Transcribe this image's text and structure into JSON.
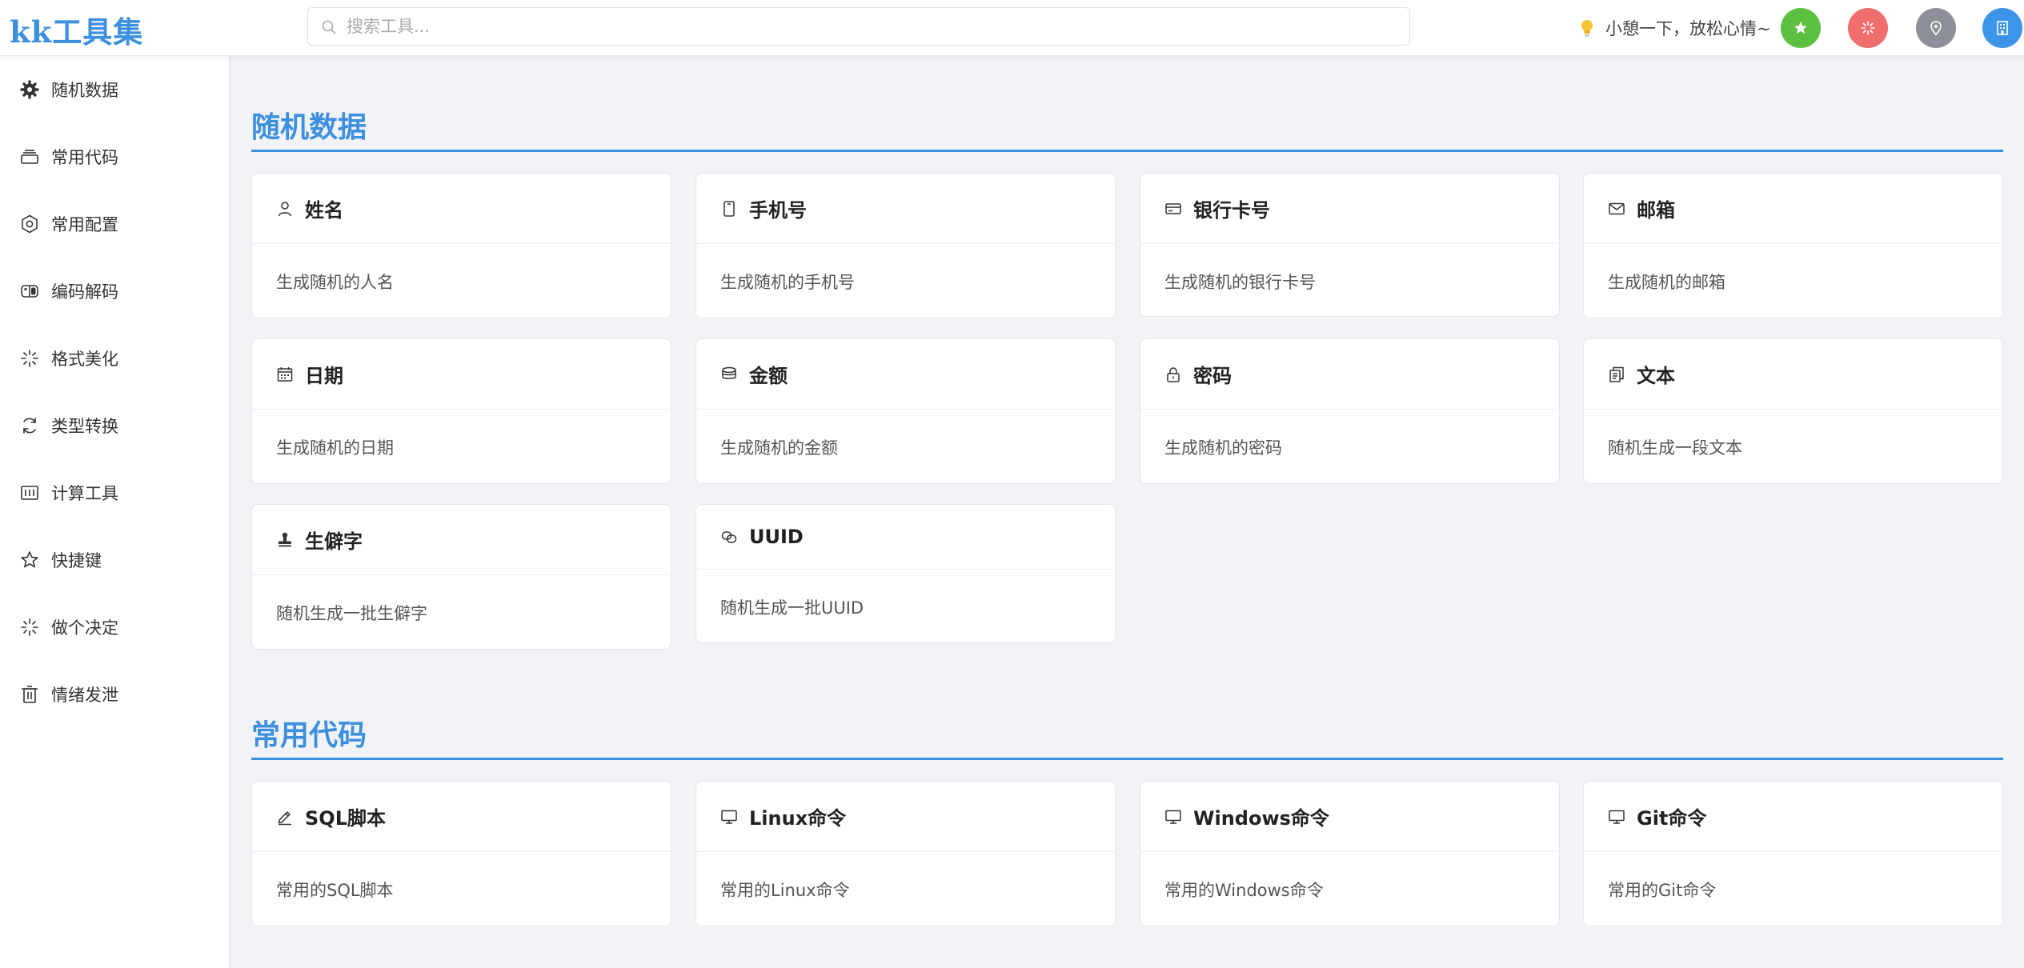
{
  "header": {
    "logo": "kk工具集",
    "search_placeholder": "搜索工具...",
    "tip": "小憩一下，放松心情~",
    "buttons": [
      {
        "icon": "star-icon",
        "color": "#5cc041"
      },
      {
        "icon": "sparkle-icon",
        "color": "#f26d6d"
      },
      {
        "icon": "pin-icon",
        "color": "#8d9096"
      },
      {
        "icon": "building-icon",
        "color": "#3d95ea"
      }
    ]
  },
  "sidebar": {
    "items": [
      {
        "label": "随机数据",
        "icon": "gear-icon"
      },
      {
        "label": "常用代码",
        "icon": "stack-icon"
      },
      {
        "label": "常用配置",
        "icon": "settings-icon"
      },
      {
        "label": "编码解码",
        "icon": "switch-icon"
      },
      {
        "label": "格式美化",
        "icon": "loading-icon"
      },
      {
        "label": "类型转换",
        "icon": "refresh-icon"
      },
      {
        "label": "计算工具",
        "icon": "calculator-icon"
      },
      {
        "label": "快捷键",
        "icon": "star-outline-icon"
      },
      {
        "label": "做个决定",
        "icon": "loading-icon"
      },
      {
        "label": "情绪发泄",
        "icon": "trash-icon"
      }
    ]
  },
  "sections": [
    {
      "title": "随机数据",
      "cards": [
        {
          "title": "姓名",
          "desc": "生成随机的人名",
          "icon": "user-icon"
        },
        {
          "title": "手机号",
          "desc": "生成随机的手机号",
          "icon": "phone-icon"
        },
        {
          "title": "银行卡号",
          "desc": "生成随机的银行卡号",
          "icon": "credit-card-icon"
        },
        {
          "title": "邮箱",
          "desc": "生成随机的邮箱",
          "icon": "mail-icon"
        },
        {
          "title": "日期",
          "desc": "生成随机的日期",
          "icon": "calendar-icon"
        },
        {
          "title": "金额",
          "desc": "生成随机的金额",
          "icon": "coins-icon"
        },
        {
          "title": "密码",
          "desc": "生成随机的密码",
          "icon": "lock-icon"
        },
        {
          "title": "文本",
          "desc": "随机生成一段文本",
          "icon": "copy-document-icon"
        },
        {
          "title": "生僻字",
          "desc": "随机生成一批生僻字",
          "icon": "stamp-icon"
        },
        {
          "title": "UUID",
          "desc": "随机生成一批UUID",
          "icon": "link-icon"
        }
      ]
    },
    {
      "title": "常用代码",
      "cards": [
        {
          "title": "SQL脚本",
          "desc": "常用的SQL脚本",
          "icon": "edit-pen-icon"
        },
        {
          "title": "Linux命令",
          "desc": "常用的Linux命令",
          "icon": "monitor-icon"
        },
        {
          "title": "Windows命令",
          "desc": "常用的Windows命令",
          "icon": "monitor-icon"
        },
        {
          "title": "Git命令",
          "desc": "常用的Git命令",
          "icon": "monitor-icon"
        }
      ]
    }
  ]
}
